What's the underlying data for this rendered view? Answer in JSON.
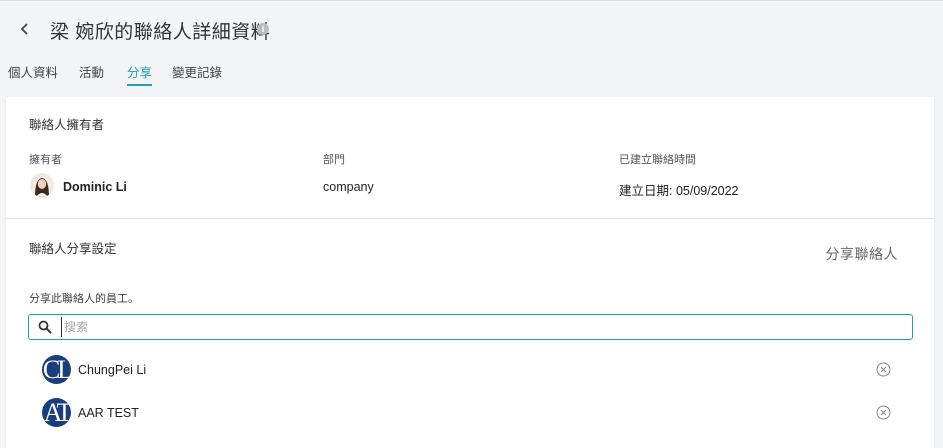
{
  "header": {
    "title": "梁 婉欣的聯絡人詳細資料",
    "info_icon": "i",
    "back_icon": "chevron-left-icon"
  },
  "tabs": [
    {
      "label": "個人資料",
      "active": false
    },
    {
      "label": "活動",
      "active": false
    },
    {
      "label": "分享",
      "active": true
    },
    {
      "label": "變更記錄",
      "active": false
    }
  ],
  "owner_section": {
    "title": "聯絡人擁有者",
    "columns": {
      "owner_label": "擁有者",
      "department_label": "部門",
      "created_label": "已建立聯絡時間"
    },
    "owner_name": "Dominic Li",
    "department": "company",
    "created_date": "建立日期: 05/09/2022"
  },
  "share_section": {
    "title": "聯絡人分享設定",
    "share_button": "分享聯絡人",
    "description": "分享此聯絡人的員工。",
    "search": {
      "placeholder": "搜索",
      "value": ""
    },
    "employees": [
      {
        "initials": "CL",
        "name": "ChungPei Li"
      },
      {
        "initials": "AT",
        "name": "AAR TEST"
      }
    ]
  },
  "colors": {
    "accent": "#2a9bb3",
    "avatar_bg": "#1b3d7b",
    "page_bg": "#f3f4f6"
  }
}
